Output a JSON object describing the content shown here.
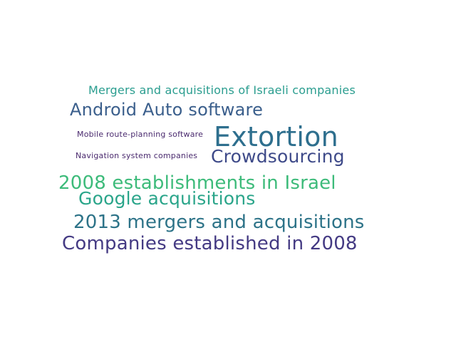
{
  "words": [
    {
      "text": "Mergers and acquisitions of Israeli companies",
      "color": "#2a9d8f"
    },
    {
      "text": "Android Auto software",
      "color": "#3b5f8c"
    },
    {
      "text": "Mobile route-planning software",
      "color": "#4a2a6e"
    },
    {
      "text": "Extortion",
      "color": "#2e6f8e"
    },
    {
      "text": "Navigation system companies",
      "color": "#4a2a6e"
    },
    {
      "text": "Crowdsourcing",
      "color": "#3e4a89"
    },
    {
      "text": "2008 establishments in Israel",
      "color": "#3dbb7a"
    },
    {
      "text": "Google acquisitions",
      "color": "#2aa58a"
    },
    {
      "text": "2013 mergers and acquisitions",
      "color": "#2d7388"
    },
    {
      "text": "Companies established in 2008",
      "color": "#443a83"
    }
  ]
}
